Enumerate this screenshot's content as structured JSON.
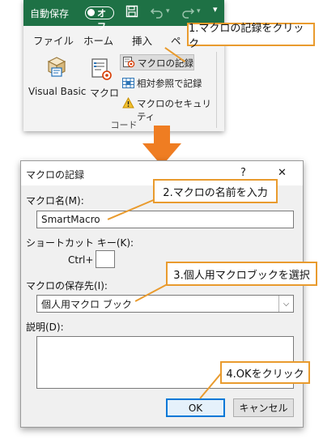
{
  "ribbon": {
    "autosave_label": "自動保存",
    "toggle_label": "オフ",
    "menu": [
      "ファイル",
      "ホーム",
      "挿入",
      "ペ"
    ],
    "visual_basic_label": "Visual Basic",
    "macro_label": "マクロ",
    "record_macro_label": "マクロの記録",
    "relative_ref_label": "相対参照で記録",
    "macro_security_label": "マクロのセキュリティ",
    "group_label": "コード"
  },
  "callouts": {
    "step1": "1.マクロの記録をクリック",
    "step2": "2.マクロの名前を入力",
    "step3": "3.個人用マクロブックを選択",
    "step4": "4.OKをクリック"
  },
  "dialog": {
    "title": "マクロの記録",
    "help_glyph": "?",
    "close_glyph": "✕",
    "macro_name_label": "マクロ名(M):",
    "macro_name_value": "SmartMacro",
    "shortcut_label": "ショートカット キー(K):",
    "ctrl_prefix": "Ctrl+",
    "shortcut_value": "",
    "store_in_label": "マクロの保存先(I):",
    "store_in_value": "個人用マクロ ブック",
    "description_label": "説明(D):",
    "description_value": "",
    "ok_label": "OK",
    "cancel_label": "キャンセル"
  },
  "colors": {
    "excel_green": "#1e7145",
    "callout_orange": "#e99b2e",
    "arrow_orange": "#ef7d22",
    "ok_focus_blue": "#0078d7"
  }
}
